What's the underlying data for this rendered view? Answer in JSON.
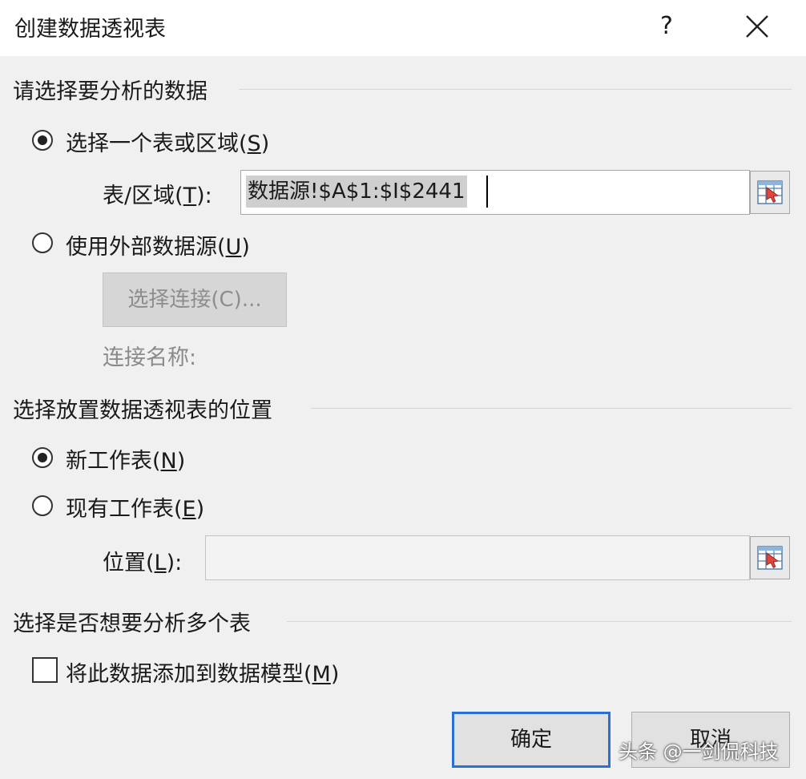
{
  "dialog": {
    "title": "创建数据透视表",
    "help": "?"
  },
  "source_section": {
    "heading": "请选择要分析的数据",
    "option_table": {
      "text": "选择一个表或区域(",
      "key": "S",
      "end": ")",
      "selected": true
    },
    "range_label": {
      "text": "表/区域(",
      "key": "T",
      "end": "):"
    },
    "range_value": "数据源!$A$1:$I$2441",
    "option_external": {
      "text": "使用外部数据源(",
      "key": "U",
      "end": ")",
      "selected": false
    },
    "choose_connection": "选择连接(C)...",
    "connection_name_label": "连接名称:"
  },
  "location_section": {
    "heading": "选择放置数据透视表的位置",
    "option_new": {
      "text": "新工作表(",
      "key": "N",
      "end": ")",
      "selected": true
    },
    "option_existing": {
      "text": "现有工作表(",
      "key": "E",
      "end": ")",
      "selected": false
    },
    "location_label": {
      "text": "位置(",
      "key": "L",
      "end": "):"
    },
    "location_value": ""
  },
  "multi_section": {
    "heading": "选择是否想要分析多个表",
    "add_to_model": {
      "text": "将此数据添加到数据模型(",
      "key": "M",
      "end": ")",
      "checked": false
    }
  },
  "buttons": {
    "ok": "确定",
    "cancel": "取消"
  },
  "watermark": "头条 @一剑侃科技"
}
